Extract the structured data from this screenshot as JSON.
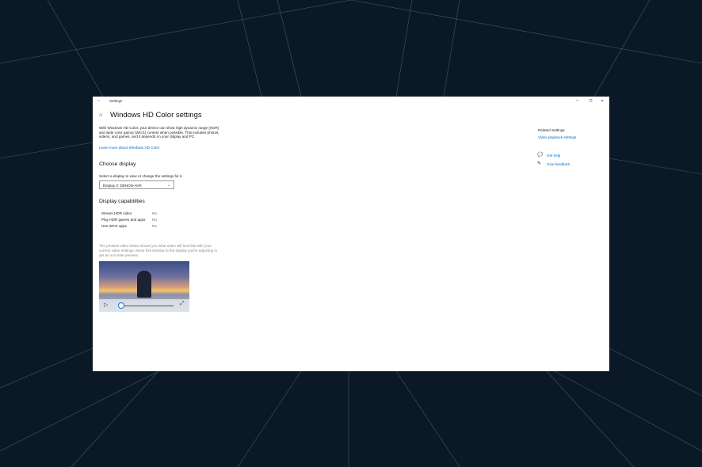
{
  "window": {
    "app_title": "Settings",
    "minimize": "–",
    "restore": "❐",
    "close": "✕"
  },
  "page": {
    "title": "Windows HD Color settings",
    "description": "With Windows HD Color, your device can show high dynamic range (HDR) and wide color gamut (WCG) content when possible. This includes photos, videos, and games, and it depends on your display and PC.",
    "learn_more": "Learn more about Windows HD Color"
  },
  "choose_display": {
    "heading": "Choose display",
    "label": "Select a display to view or change the settings for it.",
    "selected": "Display 2: DENON-AVR"
  },
  "capabilities": {
    "heading": "Display capabilities",
    "rows": [
      {
        "label": "Stream HDR video",
        "value": "No"
      },
      {
        "label": "Play HDR games and apps",
        "value": "No"
      },
      {
        "label": "Use WCG apps",
        "value": "No"
      }
    ]
  },
  "preview": {
    "text": "The preview video below shows you what video will look like with your current video settings. Move this window to the display you're adjusting to get an accurate preview.",
    "progress": 0.05
  },
  "related": {
    "heading": "Related Settings",
    "link": "Video playback settings",
    "help": "Get help",
    "feedback": "Give feedback"
  }
}
